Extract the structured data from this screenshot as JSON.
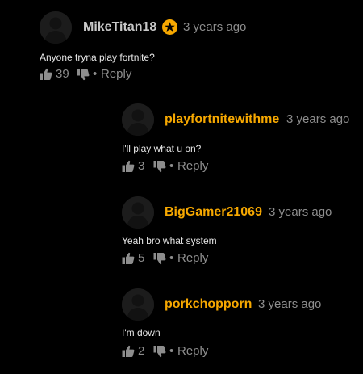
{
  "colors": {
    "background": "#000000",
    "username_default": "#c8c8c8",
    "username_highlight": "#f7a800",
    "meta_text": "#8d8d8d",
    "body_text": "#e6e6e6",
    "badge": "#f7a800"
  },
  "comments": [
    {
      "username": "MikeTitan18",
      "username_color": "#c8c8c8",
      "has_badge": true,
      "badge_icon": "star-icon",
      "timestamp": "3 years ago",
      "text": "Anyone tryna play fortnite?",
      "like_count": "39",
      "separator": "•",
      "reply_label": "Reply"
    },
    {
      "username": "playfortnitewithme",
      "username_color": "#f7a800",
      "has_badge": false,
      "timestamp": "3 years ago",
      "text": "I'll play what u on?",
      "like_count": "3",
      "separator": "•",
      "reply_label": "Reply"
    },
    {
      "username": "BigGamer21069",
      "username_color": "#f7a800",
      "has_badge": false,
      "timestamp": "3 years ago",
      "text": "Yeah bro what system",
      "like_count": "5",
      "separator": "•",
      "reply_label": "Reply"
    },
    {
      "username": "porkchopporn",
      "username_color": "#f7a800",
      "has_badge": false,
      "timestamp": "3 years ago",
      "text": "I'm down",
      "like_count": "2",
      "separator": "•",
      "reply_label": "Reply"
    }
  ]
}
